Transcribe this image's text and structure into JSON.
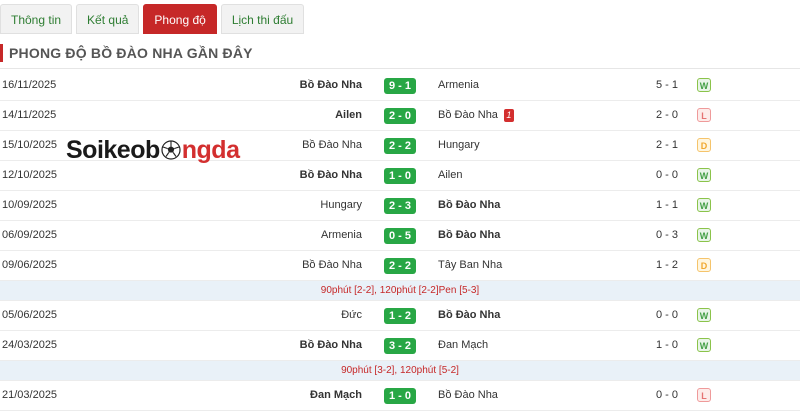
{
  "tabs": [
    {
      "label": "Thông tin",
      "active": false
    },
    {
      "label": "Kết quả",
      "active": false
    },
    {
      "label": "Phong độ",
      "active": true
    },
    {
      "label": "Lịch thi đấu",
      "active": false
    }
  ],
  "section_title": "PHONG ĐỘ BỒ ĐÀO NHA GẦN ĐÂY",
  "watermark": {
    "part1": "Soikeob",
    "part2": "ngda",
    "ball_icon": "soccer-ball-icon"
  },
  "colors": {
    "accent": "#c62828",
    "score_bg": "#28a745",
    "win": "#43a047",
    "loss": "#e57373",
    "draw": "#f0a830"
  },
  "matches": [
    {
      "date": "16/11/2025",
      "home": "Bồ Đào Nha",
      "home_bold": true,
      "score": "9 - 1",
      "away": "Armenia",
      "away_bold": false,
      "half_time": "5 - 1",
      "result": "W"
    },
    {
      "date": "14/11/2025",
      "home": "Ailen",
      "home_bold": true,
      "score": "2 - 0",
      "away": "Bồ Đào Nha",
      "away_bold": false,
      "red_card": "1",
      "half_time": "2 - 0",
      "result": "L"
    },
    {
      "date": "15/10/2025",
      "home": "Bồ Đào Nha",
      "home_bold": false,
      "score": "2 - 2",
      "away": "Hungary",
      "away_bold": false,
      "half_time": "2 - 1",
      "result": "D"
    },
    {
      "date": "12/10/2025",
      "home": "Bồ Đào Nha",
      "home_bold": true,
      "score": "1 - 0",
      "away": "Ailen",
      "away_bold": false,
      "half_time": "0 - 0",
      "result": "W"
    },
    {
      "date": "10/09/2025",
      "home": "Hungary",
      "home_bold": false,
      "score": "2 - 3",
      "away": "Bồ Đào Nha",
      "away_bold": true,
      "half_time": "1 - 1",
      "result": "W"
    },
    {
      "date": "06/09/2025",
      "home": "Armenia",
      "home_bold": false,
      "score": "0 - 5",
      "away": "Bồ Đào Nha",
      "away_bold": true,
      "half_time": "0 - 3",
      "result": "W"
    },
    {
      "date": "09/06/2025",
      "home": "Bồ Đào Nha",
      "home_bold": false,
      "score": "2 - 2",
      "away": "Tây Ban Nha",
      "away_bold": false,
      "half_time": "1 - 2",
      "result": "D",
      "note": "90phút [2-2], 120phút [2-2]Pen [5-3]"
    },
    {
      "date": "05/06/2025",
      "home": "Đức",
      "home_bold": false,
      "score": "1 - 2",
      "away": "Bồ Đào Nha",
      "away_bold": true,
      "half_time": "0 - 0",
      "result": "W"
    },
    {
      "date": "24/03/2025",
      "home": "Bồ Đào Nha",
      "home_bold": true,
      "score": "3 - 2",
      "away": "Đan Mạch",
      "away_bold": false,
      "half_time": "1 - 0",
      "result": "W",
      "note": "90phút [3-2], 120phút [5-2]"
    },
    {
      "date": "21/03/2025",
      "home": "Đan Mạch",
      "home_bold": true,
      "score": "1 - 0",
      "away": "Bồ Đào Nha",
      "away_bold": false,
      "half_time": "0 - 0",
      "result": "L"
    }
  ]
}
